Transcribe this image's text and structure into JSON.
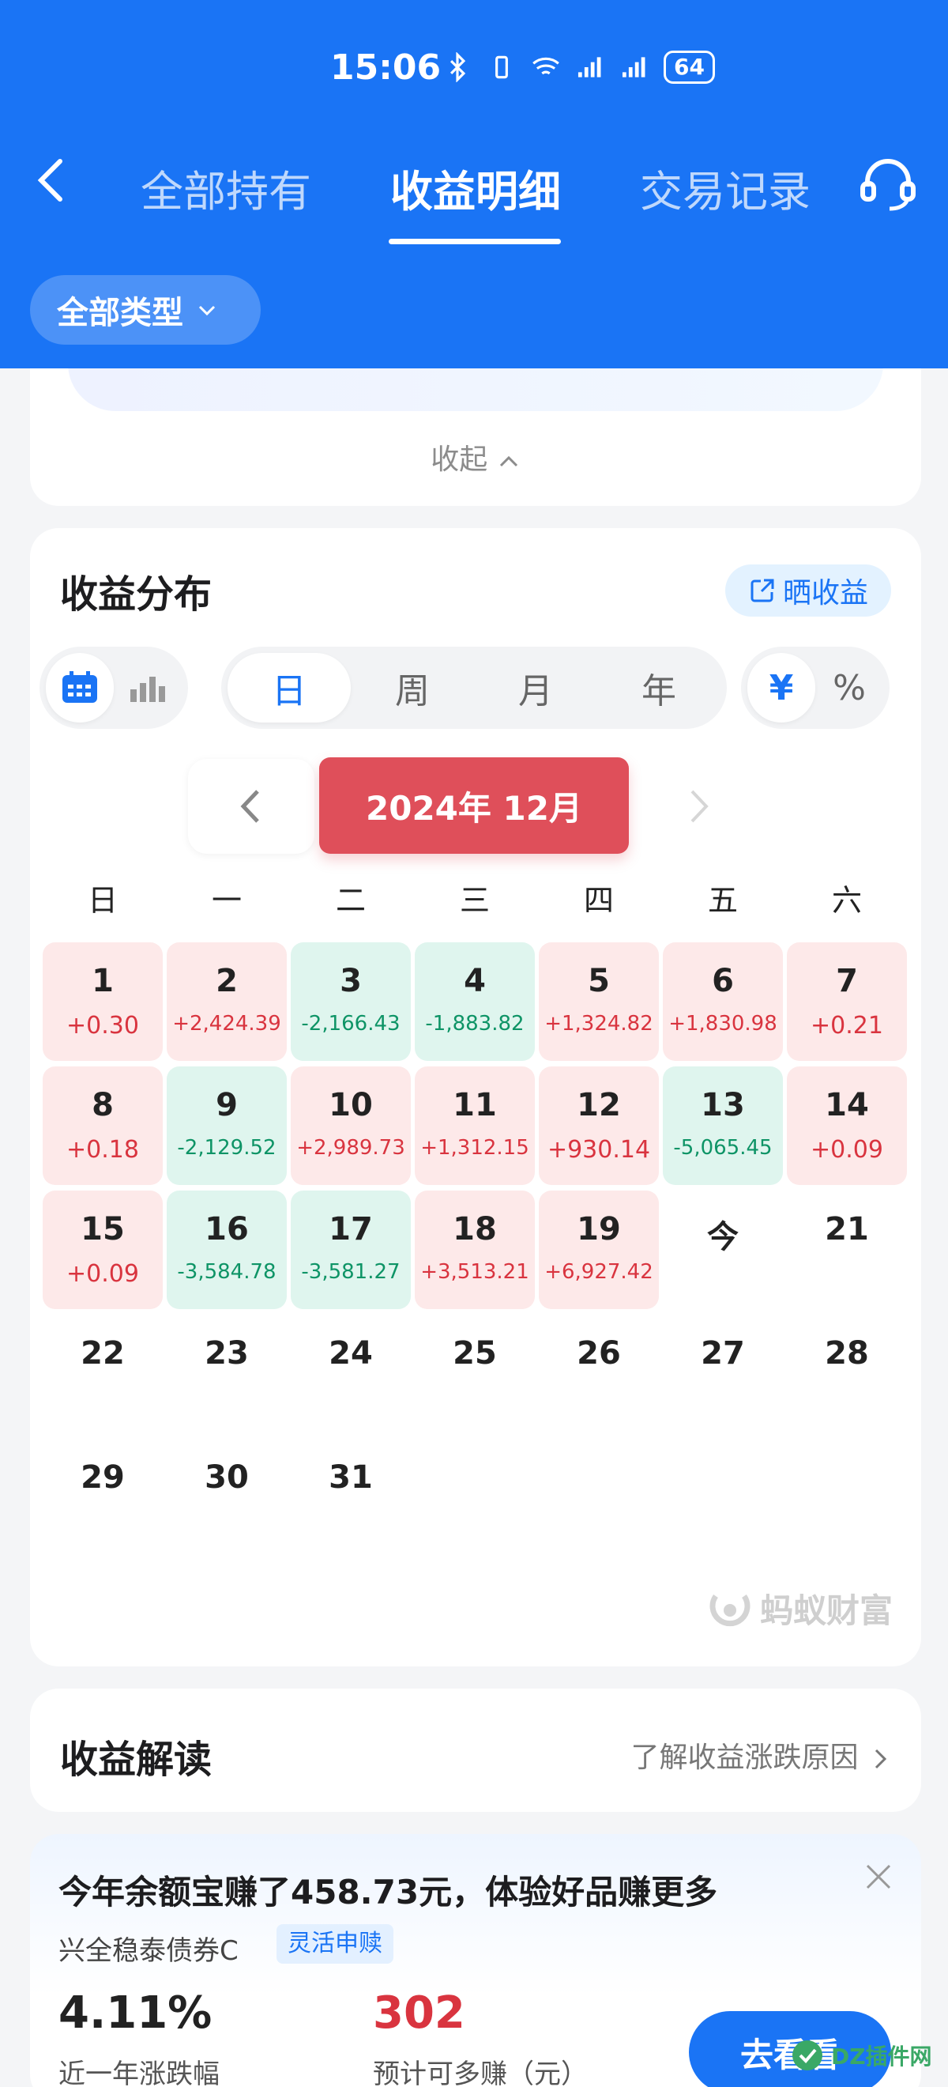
{
  "status": {
    "time": "15:06",
    "battery": "64"
  },
  "tabs": [
    {
      "label": "全部持有"
    },
    {
      "label": "收益明细"
    },
    {
      "label": "交易记录"
    }
  ],
  "filter": {
    "label": "全部类型"
  },
  "top_card": {
    "collapse_label": "收起"
  },
  "distribution": {
    "title": "收益分布",
    "share_label": "晒收益",
    "periods": [
      "日",
      "周",
      "月",
      "年"
    ],
    "units": [
      "¥",
      "%"
    ],
    "month_label": "2024年 12月",
    "weekdays": [
      "日",
      "一",
      "二",
      "三",
      "四",
      "五",
      "六"
    ],
    "days": [
      {
        "d": "1",
        "v": "+0.30",
        "t": "pos",
        "big": true
      },
      {
        "d": "2",
        "v": "+2,424.39",
        "t": "pos"
      },
      {
        "d": "3",
        "v": "-2,166.43",
        "t": "neg"
      },
      {
        "d": "4",
        "v": "-1,883.82",
        "t": "neg"
      },
      {
        "d": "5",
        "v": "+1,324.82",
        "t": "pos"
      },
      {
        "d": "6",
        "v": "+1,830.98",
        "t": "pos"
      },
      {
        "d": "7",
        "v": "+0.21",
        "t": "pos",
        "big": true
      },
      {
        "d": "8",
        "v": "+0.18",
        "t": "pos",
        "big": true
      },
      {
        "d": "9",
        "v": "-2,129.52",
        "t": "neg"
      },
      {
        "d": "10",
        "v": "+2,989.73",
        "t": "pos"
      },
      {
        "d": "11",
        "v": "+1,312.15",
        "t": "pos"
      },
      {
        "d": "12",
        "v": "+930.14",
        "t": "pos",
        "big": true
      },
      {
        "d": "13",
        "v": "-5,065.45",
        "t": "neg"
      },
      {
        "d": "14",
        "v": "+0.09",
        "t": "pos",
        "big": true
      },
      {
        "d": "15",
        "v": "+0.09",
        "t": "pos",
        "big": true
      },
      {
        "d": "16",
        "v": "-3,584.78",
        "t": "neg"
      },
      {
        "d": "17",
        "v": "-3,581.27",
        "t": "neg"
      },
      {
        "d": "18",
        "v": "+3,513.21",
        "t": "pos"
      },
      {
        "d": "19",
        "v": "+6,927.42",
        "t": "pos"
      },
      {
        "d": "今",
        "v": "",
        "t": "none"
      },
      {
        "d": "21",
        "v": "",
        "t": "none"
      },
      {
        "d": "22",
        "v": "",
        "t": "none"
      },
      {
        "d": "23",
        "v": "",
        "t": "none"
      },
      {
        "d": "24",
        "v": "",
        "t": "none"
      },
      {
        "d": "25",
        "v": "",
        "t": "none"
      },
      {
        "d": "26",
        "v": "",
        "t": "none"
      },
      {
        "d": "27",
        "v": "",
        "t": "none"
      },
      {
        "d": "28",
        "v": "",
        "t": "none"
      },
      {
        "d": "29",
        "v": "",
        "t": "none"
      },
      {
        "d": "30",
        "v": "",
        "t": "none"
      },
      {
        "d": "31",
        "v": "",
        "t": "none"
      }
    ],
    "watermark": "蚂蚁财富"
  },
  "reading": {
    "title": "收益解读",
    "link": "了解收益涨跌原因"
  },
  "promo": {
    "title": "今年余额宝赚了458.73元，体验好品赚更多",
    "fund_name": "兴全稳泰债券C",
    "fund_tag": "灵活申赎",
    "metric1_value": "4.11%",
    "metric1_label": "近一年涨跌幅",
    "metric2_value": "302",
    "metric2_label": "预计可多赚（元）",
    "cta": "去看看"
  },
  "corner_logo": "DZ插件网",
  "colors": {
    "brand": "#1a74f5",
    "gain": "#d9343f",
    "loss": "#0e9466"
  }
}
